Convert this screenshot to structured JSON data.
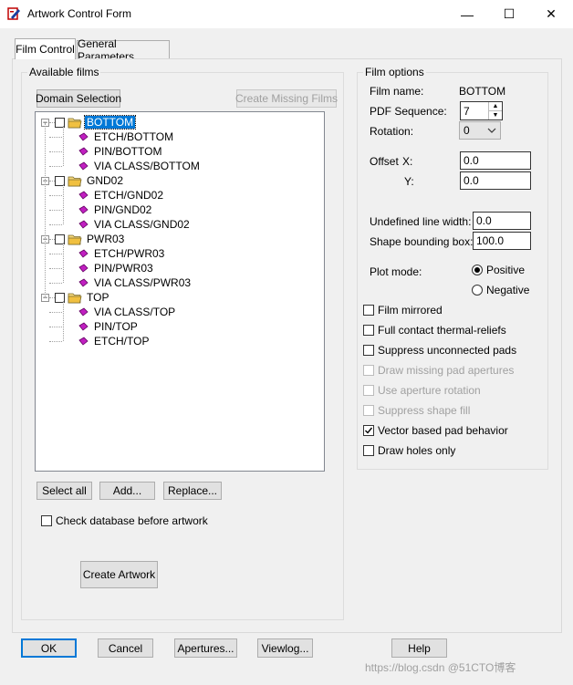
{
  "window": {
    "title": "Artwork Control Form",
    "minimize_glyph": "—",
    "maximize_glyph": "☐",
    "close_glyph": "✕"
  },
  "tabs": [
    {
      "label": "Film Control",
      "active": true
    },
    {
      "label": "General Parameters",
      "active": false
    }
  ],
  "available_films": {
    "group_label": "Available films",
    "domain_selection_label": "Domain Selection",
    "create_missing_label": "Create Missing Films",
    "tree": [
      {
        "label": "BOTTOM",
        "selected": true,
        "children": [
          "ETCH/BOTTOM",
          "PIN/BOTTOM",
          "VIA CLASS/BOTTOM"
        ]
      },
      {
        "label": "GND02",
        "selected": false,
        "children": [
          "ETCH/GND02",
          "PIN/GND02",
          "VIA CLASS/GND02"
        ]
      },
      {
        "label": "PWR03",
        "selected": false,
        "children": [
          "ETCH/PWR03",
          "PIN/PWR03",
          "VIA CLASS/PWR03"
        ]
      },
      {
        "label": "TOP",
        "selected": false,
        "children": [
          "VIA CLASS/TOP",
          "PIN/TOP",
          "ETCH/TOP"
        ]
      }
    ],
    "select_all_label": "Select all",
    "add_label": "Add...",
    "replace_label": "Replace...",
    "check_database_label": "Check database before artwork",
    "create_artwork_label": "Create Artwork"
  },
  "film_options": {
    "group_label": "Film options",
    "film_name_label": "Film name:",
    "film_name_value": "BOTTOM",
    "pdf_sequence_label": "PDF Sequence:",
    "pdf_sequence_value": "7",
    "rotation_label": "Rotation:",
    "rotation_value": "0",
    "offset_label": "Offset",
    "offset_x_label": "X:",
    "offset_x_value": "0.0",
    "offset_y_label": "Y:",
    "offset_y_value": "0.0",
    "undefined_line_width_label": "Undefined line width:",
    "undefined_line_width_value": "0.0",
    "shape_bounding_box_label": "Shape bounding box:",
    "shape_bounding_box_value": "100.0",
    "plot_mode_label": "Plot mode:",
    "plot_mode_positive": "Positive",
    "plot_mode_negative": "Negative",
    "plot_mode_selected": "Positive",
    "checkboxes": [
      {
        "label": "Film mirrored",
        "checked": false,
        "enabled": true
      },
      {
        "label": "Full contact thermal-reliefs",
        "checked": false,
        "enabled": true
      },
      {
        "label": "Suppress unconnected pads",
        "checked": false,
        "enabled": true
      },
      {
        "label": "Draw missing pad apertures",
        "checked": false,
        "enabled": false
      },
      {
        "label": "Use aperture rotation",
        "checked": false,
        "enabled": false
      },
      {
        "label": "Suppress shape fill",
        "checked": false,
        "enabled": false
      },
      {
        "label": "Vector based pad behavior",
        "checked": true,
        "enabled": true
      },
      {
        "label": "Draw holes only",
        "checked": false,
        "enabled": true
      }
    ]
  },
  "footer": {
    "ok_label": "OK",
    "cancel_label": "Cancel",
    "apertures_label": "Apertures...",
    "viewlog_label": "Viewlog...",
    "help_label": "Help",
    "watermark": "https://blog.csdn @51CTO博客"
  },
  "colors": {
    "selection_bg": "#0078d7",
    "film_icon": "#c020c0",
    "folder_icon": "#f0c040"
  }
}
